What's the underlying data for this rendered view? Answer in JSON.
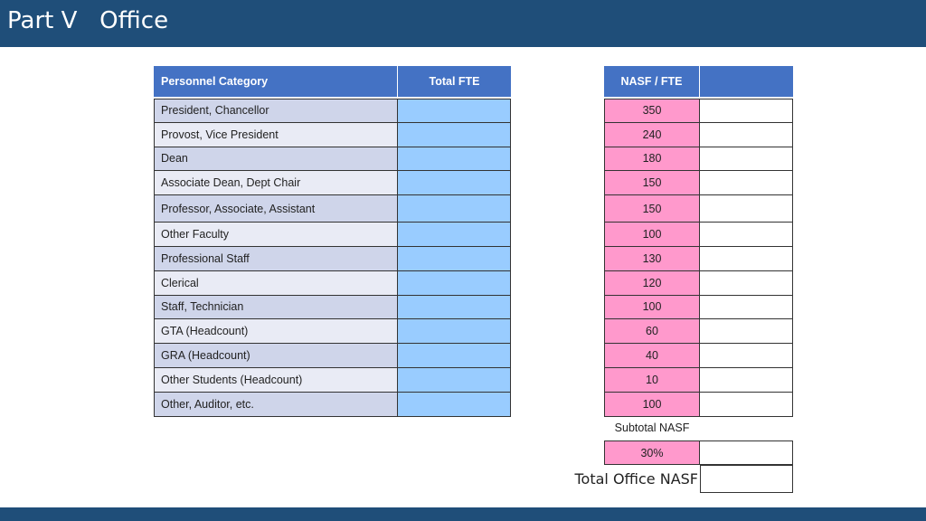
{
  "header": {
    "title": "Part V   Office"
  },
  "left_table": {
    "columns": [
      "Personnel Category",
      "Total FTE"
    ],
    "rows": [
      "President, Chancellor",
      "Provost, Vice President",
      "Dean",
      "Associate Dean, Dept Chair",
      "Professor, Associate, Assistant",
      "Other Faculty",
      "Professional Staff",
      "Clerical",
      "Staff, Technician",
      "GTA (Headcount)",
      "GRA (Headcount)",
      "Other Students (Headcount)",
      "Other, Auditor, etc."
    ]
  },
  "right_table": {
    "columns": [
      "NASF / FTE",
      ""
    ],
    "rows": [
      "350",
      "240",
      "180",
      "150",
      "150",
      "100",
      "130",
      "120",
      "100",
      "60",
      "40",
      "10",
      "100"
    ]
  },
  "subtotal": {
    "label": "Subtotal NASF",
    "percent": "30%"
  },
  "total": {
    "label": "Total Office NASF"
  },
  "colors": {
    "brand": "#1f4e79",
    "header_fill": "#4472c4",
    "fte_input": "#99ccff",
    "nasf_value": "#ff99cc"
  }
}
